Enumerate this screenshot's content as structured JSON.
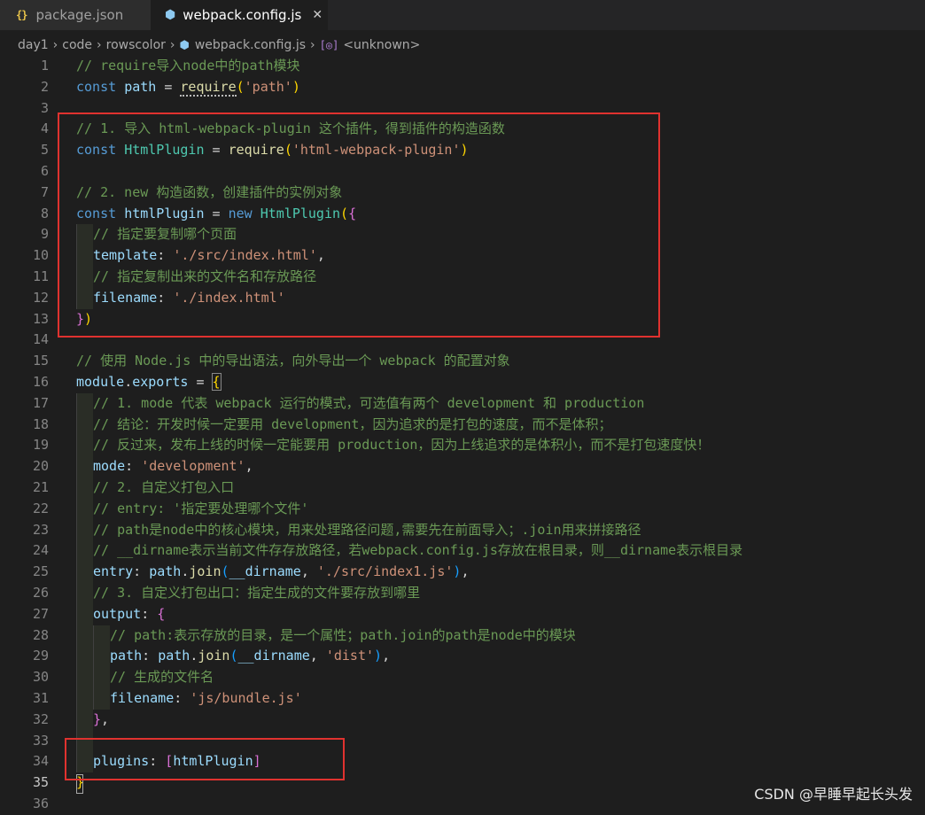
{
  "tabs": [
    {
      "icon": "{}",
      "label": "package.json",
      "active": false
    },
    {
      "label": "webpack.config.js",
      "active": true,
      "close": "✕"
    }
  ],
  "breadcrumb": [
    "day1",
    "code",
    "rowscolor",
    "webpack.config.js",
    "<unknown>"
  ],
  "breadcrumb_separator": "›",
  "watermark": "CSDN @早睡早起长头发",
  "line_numbers": [
    "1",
    "2",
    "3",
    "4",
    "5",
    "6",
    "7",
    "8",
    "9",
    "10",
    "11",
    "12",
    "13",
    "14",
    "15",
    "16",
    "17",
    "18",
    "19",
    "20",
    "21",
    "22",
    "23",
    "24",
    "25",
    "26",
    "27",
    "28",
    "29",
    "30",
    "31",
    "32",
    "33",
    "34",
    "35",
    "36"
  ],
  "code": {
    "l1": "// require导入node中的path模块",
    "l2": {
      "kw": "const",
      "var": "path",
      "eq": " = ",
      "fn": "require",
      "open": "(",
      "str": "'path'",
      "close": ")"
    },
    "l4": "// 1. 导入 html-webpack-plugin 这个插件，得到插件的构造函数",
    "l5": {
      "kw": "const",
      "cls": "HtmlPlugin",
      "eq": " = ",
      "fn": "require",
      "open": "(",
      "str": "'html-webpack-plugin'",
      "close": ")"
    },
    "l7": "// 2. new 构造函数，创建插件的实例对象",
    "l8": {
      "kw": "const",
      "var": "htmlPlugin",
      "eq": " = ",
      "new": "new",
      "cls": "HtmlPlugin",
      "open": "(",
      "brace": "{"
    },
    "l9": "// 指定要复制哪个页面",
    "l10": {
      "key": "template",
      "colon": ": ",
      "str": "'./src/index.html'",
      "comma": ","
    },
    "l11": "// 指定复制出来的文件名和存放路径",
    "l12": {
      "key": "filename",
      "colon": ": ",
      "str": "'./index.html'"
    },
    "l13": {
      "brace": "}",
      "paren": ")"
    },
    "l15": "// 使用 Node.js 中的导出语法，向外导出一个 webpack 的配置对象",
    "l16": {
      "obj": "module",
      "dot": ".",
      "prop": "exports",
      "eq": " = ",
      "brace": "{"
    },
    "l17": "// 1. mode 代表 webpack 运行的模式，可选值有两个 development 和 production",
    "l18": "// 结论：开发时候一定要用 development，因为追求的是打包的速度，而不是体积；",
    "l19": "// 反过来，发布上线的时候一定能要用 production，因为上线追求的是体积小，而不是打包速度快！",
    "l20": {
      "key": "mode",
      "colon": ": ",
      "str": "'development'",
      "comma": ","
    },
    "l21": "// 2. 自定义打包入口",
    "l22": "// entry: '指定要处理哪个文件'",
    "l23": "// path是node中的核心模块，用来处理路径问题,需要先在前面导入；.join用来拼接路径",
    "l24": "// __dirname表示当前文件存存放路径，若webpack.config.js存放在根目录，则__dirname表示根目录",
    "l25": {
      "key": "entry",
      "colon": ": ",
      "obj": "path",
      "dot": ".",
      "fn": "join",
      "open": "(",
      "arg": "__dirname",
      "sep": ", ",
      "str": "'./src/index1.js'",
      "close": ")",
      "comma": ","
    },
    "l26": "// 3. 自定义打包出口：指定生成的文件要存放到哪里",
    "l27": {
      "key": "output",
      "colon": ": ",
      "brace": "{"
    },
    "l28": "// path:表示存放的目录，是一个属性；path.join的path是node中的模块",
    "l29": {
      "key": "path",
      "colon": ": ",
      "obj": "path",
      "dot": ".",
      "fn": "join",
      "open": "(",
      "arg": "__dirname",
      "sep": ", ",
      "str": "'dist'",
      "close": ")",
      "comma": ","
    },
    "l30": "// 生成的文件名",
    "l31": {
      "key": "filename",
      "colon": ": ",
      "str": "'js/bundle.js'"
    },
    "l32": {
      "brace": "}",
      "comma": ","
    },
    "l34": {
      "key": "plugins",
      "colon": ": ",
      "open": "[",
      "var": "htmlPlugin",
      "close": "]"
    },
    "l35": {
      "brace": "}"
    }
  },
  "colors": {
    "background": "#1e1e1e",
    "comment": "#6a9955",
    "keyword": "#569cd6",
    "variable": "#9cdcfe",
    "function": "#dcdcaa",
    "string": "#ce9178",
    "class": "#4ec9b0",
    "highlight_box": "#e0322f"
  }
}
